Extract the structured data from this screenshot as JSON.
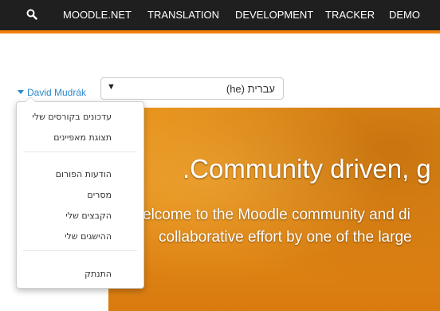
{
  "nav": {
    "search_icon": "search-icon",
    "items": [
      "MOODLE.NET",
      "TRANSLATION",
      "DEVELOPMENT",
      "TRACKER",
      "DEMO"
    ]
  },
  "colors": {
    "nav_background": "#1f1f1f",
    "nav_accent": "#f0800a",
    "link": "#2a86c7",
    "hero": "#e28a16"
  },
  "user": {
    "name": "David Mudrák"
  },
  "language": {
    "selected": "עברית (he)",
    "arrow": "▼"
  },
  "user_menu": {
    "group1": [
      "עדכונים בקורסים שלי",
      "תצוגת מאפיינים"
    ],
    "group2": [
      "הודעות הפורום",
      "מסרים",
      "הקבצים שלי",
      "ההישגים שלי"
    ],
    "group3": [
      "התנתק"
    ]
  },
  "hero": {
    "title": ".Community driven, g",
    "line1": "elcome to the Moodle community and di",
    "line2": "collaborative effort by one of the large"
  }
}
